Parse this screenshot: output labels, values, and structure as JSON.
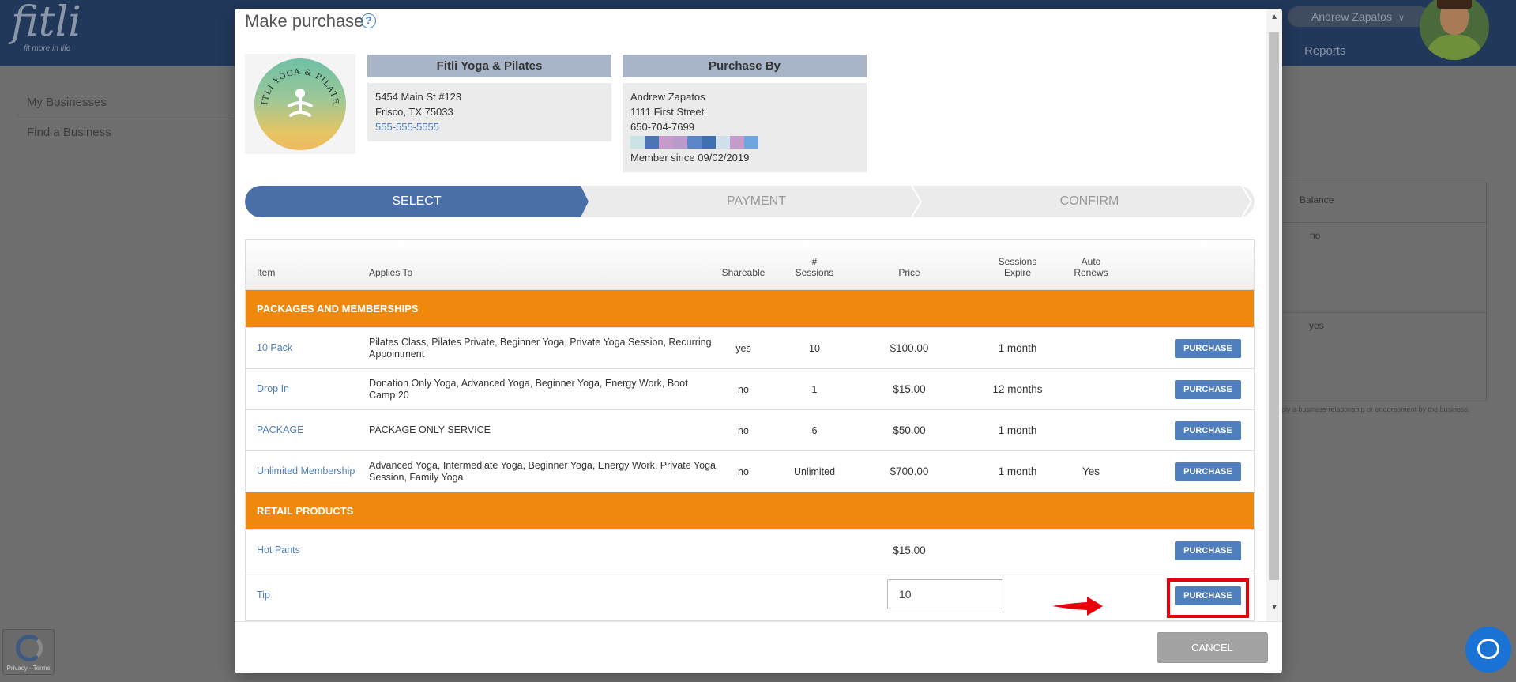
{
  "background": {
    "logo": "fitli",
    "logo_tagline": "fit more in life",
    "user_name": "Andrew Zapatos",
    "nav_reports": "Reports",
    "sidebar": [
      "My Businesses",
      "Find a Business"
    ],
    "table_header_balance": "Balance",
    "balance_values": [
      "no",
      "yes"
    ],
    "disclaimer": "ply a business relationship or endorsement by the business.",
    "recaptcha_text": "Privacy - Terms"
  },
  "modal": {
    "title": "Make purchase",
    "help_icon": "?",
    "business": {
      "heading": "Fitli Yoga & Pilates",
      "address1": "5454 Main St #123",
      "address2": "Frisco, TX 75033",
      "phone": "555-555-5555",
      "logo_text": "FITLI YOGA & PILATES"
    },
    "purchaser": {
      "heading": "Purchase By",
      "name": "Andrew Zapatos",
      "address": "1111 First Street",
      "phone": "650-704-7699",
      "member_since": "Member since 09/02/2019",
      "redaction_colors": [
        "#c9e3e6",
        "#4a74b5",
        "#c49bc9",
        "#b89acb",
        "#5b86c9",
        "#3f6fb0",
        "#cfe0ec",
        "#c49bc9",
        "#6ea5de"
      ]
    },
    "steps": [
      "SELECT",
      "PAYMENT",
      "CONFIRM"
    ],
    "table": {
      "headers": {
        "item": "Item",
        "applies_to": "Applies To",
        "shareable": "Shareable",
        "sessions_l1": "#",
        "sessions_l2": "Sessions",
        "price": "Price",
        "expire_l1": "Sessions",
        "expire_l2": "Expire",
        "auto_l1": "Auto",
        "auto_l2": "Renews"
      },
      "sections": [
        {
          "title": "PACKAGES AND MEMBERSHIPS",
          "rows": [
            {
              "item": "10 Pack",
              "applies": "Pilates Class, Pilates Private, Beginner Yoga, Private Yoga Session, Recurring Appointment",
              "shareable": "yes",
              "sessions": "10",
              "price": "$100.00",
              "expire": "1 month",
              "auto": ""
            },
            {
              "item": "Drop In",
              "applies": "Donation Only Yoga, Advanced Yoga, Beginner Yoga, Energy Work, Boot Camp 20",
              "shareable": "no",
              "sessions": "1",
              "price": "$15.00",
              "expire": "12 months",
              "auto": ""
            },
            {
              "item": "PACKAGE",
              "applies": "PACKAGE ONLY SERVICE",
              "shareable": "no",
              "sessions": "6",
              "price": "$50.00",
              "expire": "1 month",
              "auto": ""
            },
            {
              "item": "Unlimited Membership",
              "applies": "Advanced Yoga, Intermediate Yoga, Beginner Yoga, Energy Work, Private Yoga Session, Family Yoga",
              "shareable": "no",
              "sessions": "Unlimited",
              "price": "$700.00",
              "expire": "1 month",
              "auto": "Yes"
            }
          ]
        },
        {
          "title": "RETAIL PRODUCTS",
          "rows": [
            {
              "item": "Hot Pants",
              "price": "$15.00"
            },
            {
              "item": "Tip",
              "input_value": "10"
            }
          ]
        }
      ],
      "purchase_label": "PURCHASE"
    },
    "cancel_label": "CANCEL"
  },
  "colors": {
    "accent_blue": "#4a6fa8",
    "section_orange": "#f0880d",
    "highlight_red": "#e8000a"
  }
}
